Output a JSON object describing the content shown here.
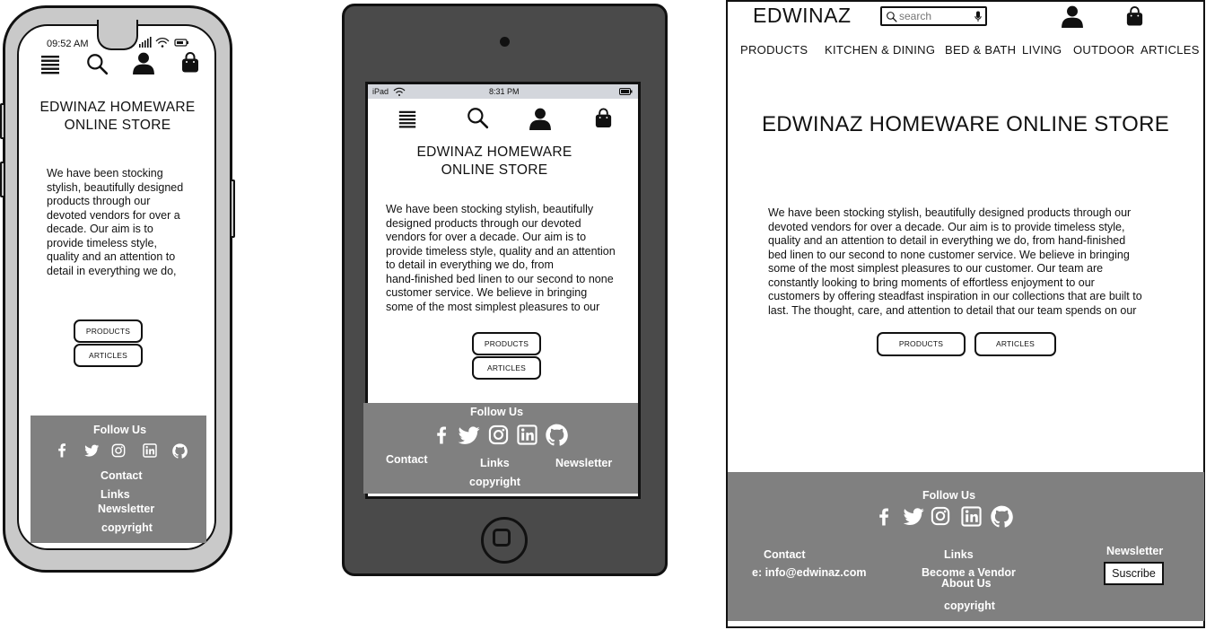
{
  "phone": {
    "time": "09:52 AM",
    "title_line1": "EDWINAZ HOMEWARE",
    "title_line2": "ONLINE STORE",
    "para_lines": [
      "We have been stocking",
      "stylish, beautifully designed",
      "products through our",
      "devoted vendors for over a",
      "decade. Our aim is to",
      "provide timeless style,",
      "quality and an attention to",
      "detail in everything we do,"
    ],
    "btn_products": "PRODUCTS",
    "btn_articles": "ARTICLES",
    "footer": {
      "follow": "Follow Us",
      "contact": "Contact",
      "links": "Links",
      "newsletter": "Newsletter",
      "copyright": "copyright"
    }
  },
  "tablet": {
    "device": "iPad",
    "time": "8:31 PM",
    "title_line1": "EDWINAZ HOMEWARE",
    "title_line2": "ONLINE STORE",
    "para_lines": [
      "We have been stocking stylish, beautifully",
      "designed products through our devoted",
      "vendors for over a decade. Our aim is to",
      "provide timeless style, quality and an attention",
      "to detail in everything we do, from",
      "hand-finished bed linen to our second to none",
      "customer service. We believe in bringing",
      "some of the most simplest pleasures to our"
    ],
    "btn_products": "PRODUCTS",
    "btn_articles": "ARTICLES",
    "footer": {
      "follow": "Follow Us",
      "contact": "Contact",
      "links": "Links",
      "newsletter": "Newsletter",
      "copyright": "copyright"
    }
  },
  "desktop": {
    "logo": "EDWINAZ",
    "search_placeholder": "search",
    "nav": [
      "PRODUCTS",
      "KITCHEN & DINING",
      "BED & BATH",
      "LIVING",
      "OUTDOOR",
      "ARTICLES"
    ],
    "title": "EDWINAZ HOMEWARE ONLINE STORE",
    "para_lines": [
      "We have been stocking stylish, beautifully designed products through our",
      "devoted vendors for over a decade. Our aim is to provide timeless style,",
      "quality and an attention to detail in everything we do, from hand-finished",
      "bed linen to our second to none customer service. We believe in bringing",
      "some of the most simplest pleasures to our customer. Our team are",
      "constantly looking to bring moments of effortless enjoyment to our",
      "customers by offering steadfast inspiration in our collections that are built to",
      "last. The thought, care, and attention to detail that our team spends on our"
    ],
    "btn_products": "PRODUCTS",
    "btn_articles": "ARTICLES",
    "footer": {
      "follow": "Follow Us",
      "contact": "Contact",
      "email": "e: info@edwinaz.com",
      "links": "Links",
      "become_vendor": "Become a Vendor",
      "about": "About Us",
      "newsletter": "Newsletter",
      "subscribe": "Suscribe",
      "copyright": "copyright"
    }
  },
  "icons": [
    "menu-icon",
    "search-icon",
    "user-icon",
    "shopping-bag-icon",
    "facebook-icon",
    "twitter-icon",
    "instagram-icon",
    "linkedin-icon",
    "github-icon",
    "microphone-icon",
    "wifi-icon",
    "battery-icon",
    "signal-icon"
  ],
  "colors": {
    "footer_bg": "#808080",
    "tablet_body": "#4a4a4a",
    "phone_body": "#c9c9c9",
    "status_bar": "#d3d6dc"
  }
}
